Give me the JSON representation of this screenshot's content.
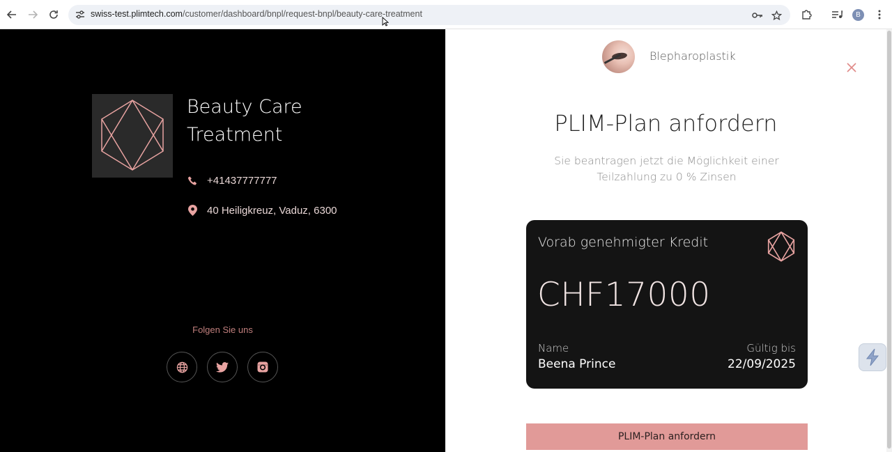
{
  "browser": {
    "url_host": "swiss-test.plimtech.com",
    "url_path": "/customer/dashboard/bnpl/request-bnpl/beauty-care-treatment",
    "profile_initial": "B",
    "icons": {
      "back": "arrow-left-icon",
      "forward": "arrow-right-icon",
      "reload": "reload-icon",
      "site_info": "tune-icon",
      "password": "key-icon",
      "bookmark": "star-icon",
      "extensions": "puzzle-icon",
      "media": "media-control-icon",
      "menu": "kebab-menu-icon"
    }
  },
  "clinic": {
    "name": "Beauty Care Treatment",
    "phone": "+41437777777",
    "address": "40 Heiligkreuz, Vaduz, 6300",
    "follow_label": "Folgen Sie uns",
    "social": [
      "globe-icon",
      "twitter-icon",
      "instagram-icon"
    ]
  },
  "treatment": {
    "name": "Blepharoplastik"
  },
  "request": {
    "title": "PLIM-Plan anfordern",
    "subtitle": "Sie beantragen jetzt die Möglichkeit einer Teilzahlung zu 0 % Zinsen",
    "submit_label": "PLIM-Plan anfordern"
  },
  "card": {
    "label": "Vorab genehmigter Kredit",
    "amount": "CHF17000",
    "name_label": "Name",
    "name_value": "Beena Prince",
    "valid_label": "Gültig bis",
    "valid_value": "22/09/2025"
  },
  "colors": {
    "accent": "#e19a98",
    "left_bg": "#000000",
    "card_bg": "#141414"
  }
}
